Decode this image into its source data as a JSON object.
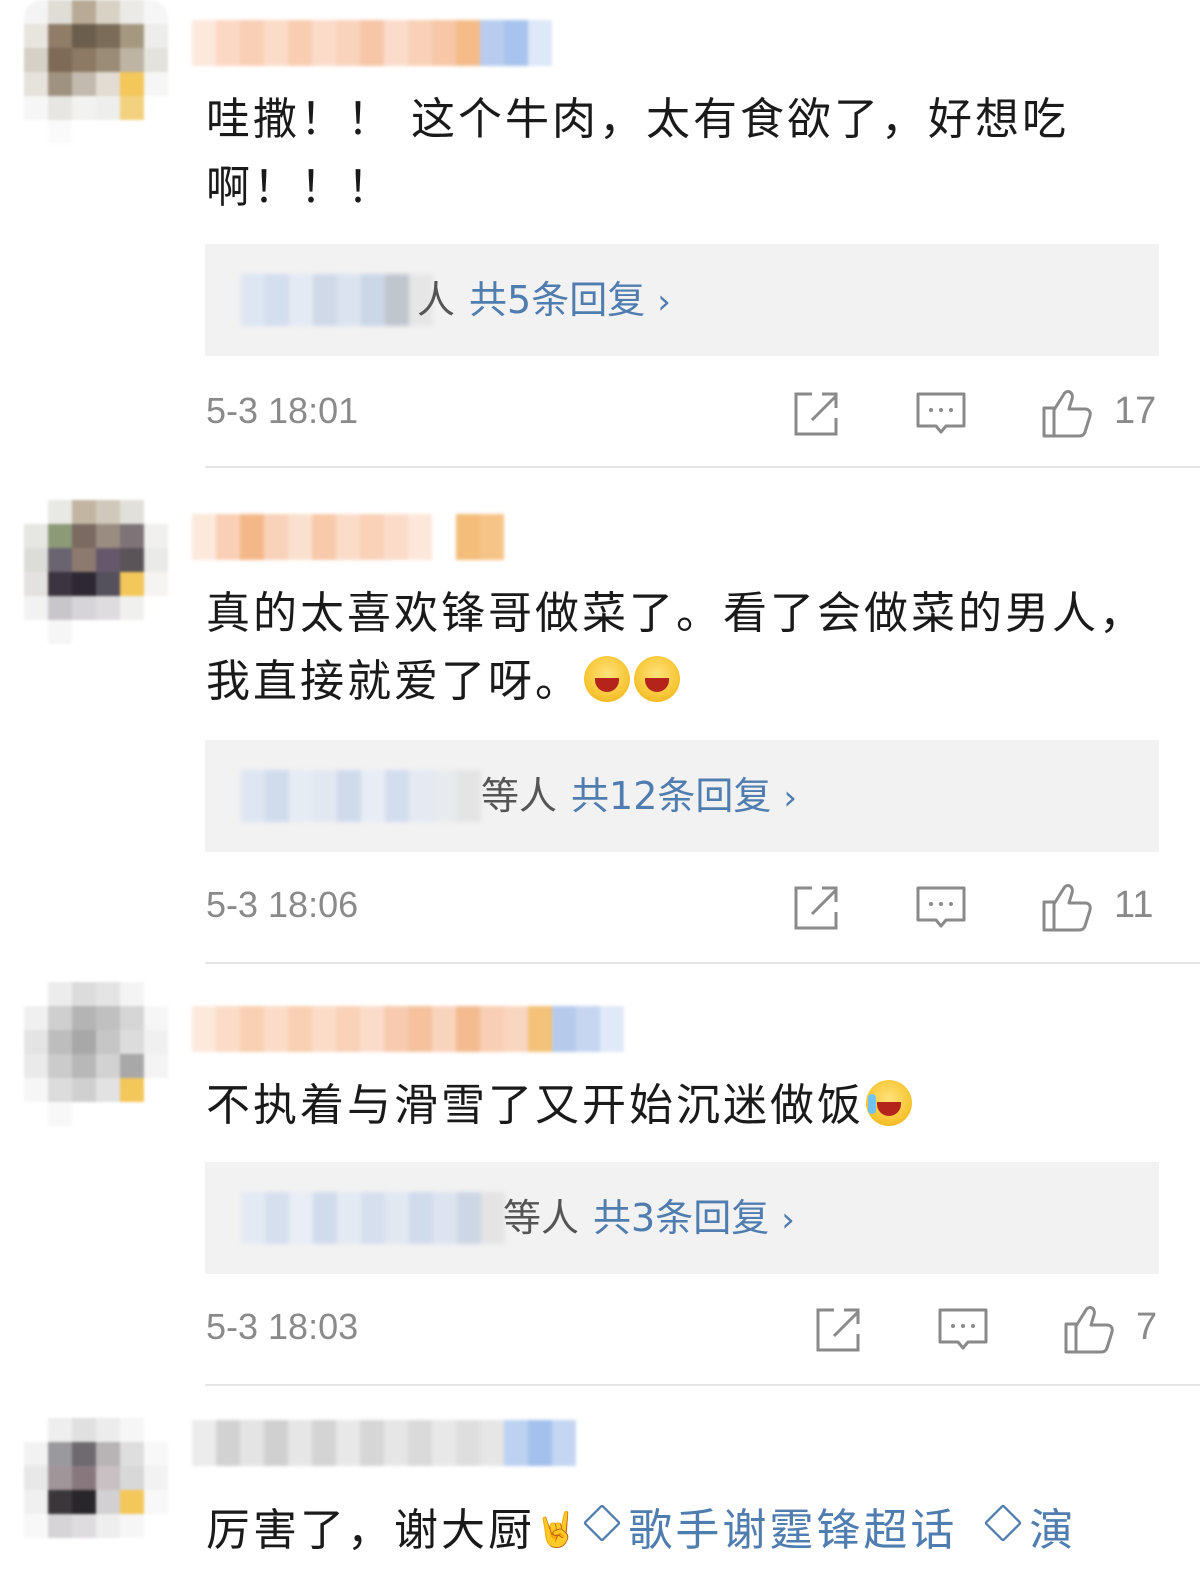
{
  "comments": [
    {
      "text": "哇撒！！ 这个牛肉，太有食欲了，好想吃啊！！！",
      "reply_prefix": "",
      "reply_partial": "人",
      "reply_count": "共5条回复",
      "time": "5-3 18:01",
      "likes": "17"
    },
    {
      "text": "真的太喜欢锋哥做菜了。看了会做菜的男人，我直接就爱了呀。",
      "emojis": [
        "laugh-emoji",
        "laugh-emoji"
      ],
      "reply_prefix": "等人",
      "reply_count": "共12条回复",
      "time": "5-3 18:06",
      "likes": "11"
    },
    {
      "text": "不执着与滑雪了又开始沉迷做饭",
      "emojis": [
        "laugh-cry-emoji"
      ],
      "reply_prefix": "等人",
      "reply_count": "共3条回复",
      "time": "5-3 18:03",
      "likes": "7"
    },
    {
      "text": "厉害了，谢大厨",
      "topic1": "歌手谢霆锋超话",
      "topic2": "演"
    }
  ],
  "icons": {
    "forward": "share-icon",
    "comment": "comment-icon",
    "like": "thumbs-up-icon",
    "chevron": "chevron-right-icon",
    "topic": "diamond-icon"
  },
  "colors": {
    "link": "#507daf",
    "time": "#8a8a8a",
    "reply_bg": "#f2f2f2"
  }
}
